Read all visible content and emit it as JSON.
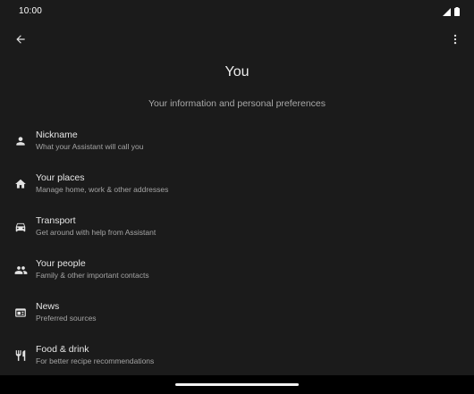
{
  "status_bar": {
    "time": "10:00",
    "icons": [
      "signal-icon",
      "battery-icon"
    ]
  },
  "app_bar": {
    "back_icon": "arrow-back-icon",
    "menu_icon": "more-vert-icon"
  },
  "header": {
    "title": "You",
    "subtitle": "Your information and personal preferences"
  },
  "list": {
    "items": [
      {
        "title": "Nickname",
        "subtitle": "What your Assistant will call you",
        "icon": "person-icon"
      },
      {
        "title": "Your places",
        "subtitle": "Manage home, work & other addresses",
        "icon": "home-icon"
      },
      {
        "title": "Transport",
        "subtitle": "Get around with help from Assistant",
        "icon": "car-icon"
      },
      {
        "title": "Your people",
        "subtitle": "Family & other important contacts",
        "icon": "people-icon"
      },
      {
        "title": "News",
        "subtitle": "Preferred sources",
        "icon": "news-icon"
      },
      {
        "title": "Food & drink",
        "subtitle": "For better recipe recommendations",
        "icon": "restaurant-icon"
      }
    ]
  },
  "colors": {
    "background": "#1b1b1b",
    "text_primary": "#e6e6e6",
    "text_secondary": "#a4a4a4",
    "icon": "#e3e3e3"
  }
}
